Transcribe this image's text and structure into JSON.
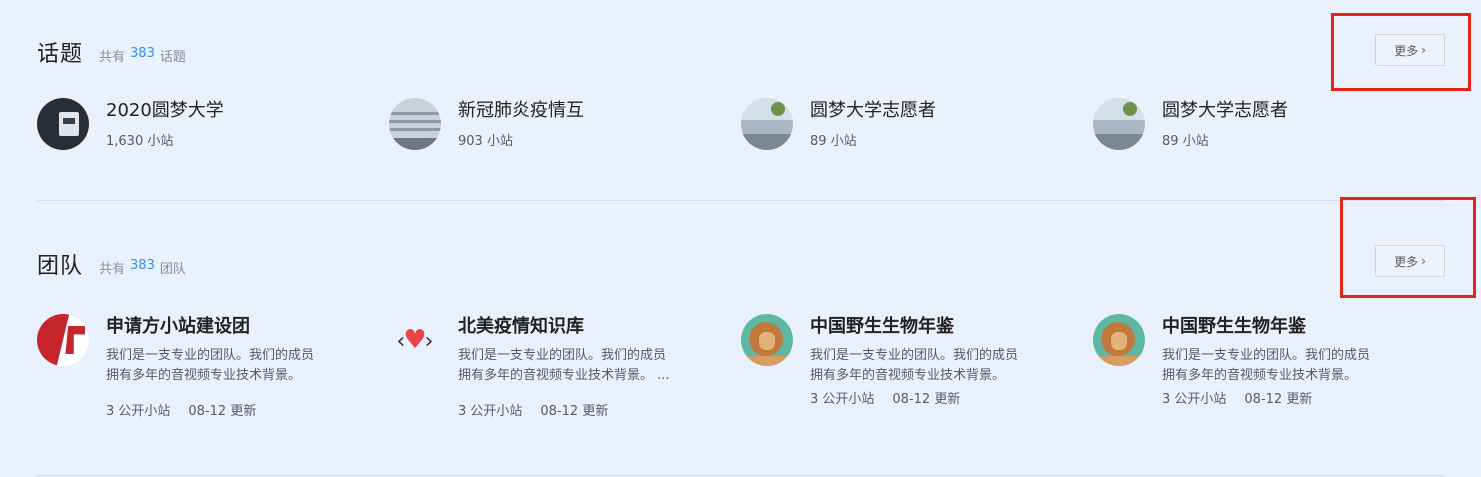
{
  "topics": {
    "title": "话题",
    "count_prefix": "共有",
    "count": "383",
    "count_suffix": "话题",
    "more_label": "更多",
    "more_icon": "chevron-right-icon",
    "items": [
      {
        "title": "2020圆梦大学",
        "sub": "1,630 小站"
      },
      {
        "title": "新冠肺炎疫情互",
        "sub": "903 小站"
      },
      {
        "title": "圆梦大学志愿者",
        "sub": "89 小站"
      },
      {
        "title": "圆梦大学志愿者",
        "sub": "89 小站"
      }
    ]
  },
  "teams": {
    "title": "团队",
    "count_prefix": "共有",
    "count": "383",
    "count_suffix": "团队",
    "more_label": "更多",
    "more_icon": "chevron-right-icon",
    "items": [
      {
        "title": "申请方小站建设团",
        "desc_1": "我们是一支专业的团队。我们的成员",
        "desc_2": "拥有多年的音视频专业技术背景。",
        "sites": "3 公开小站",
        "updated": "08-12 更新"
      },
      {
        "title": "北美疫情知识库",
        "desc_1": "我们是一支专业的团队。我们的成员",
        "desc_2": "拥有多年的音视频专业技术背景。 ...",
        "sites": "3 公开小站",
        "updated": "08-12 更新"
      },
      {
        "title": "中国野生生物年鉴",
        "desc_1": "我们是一支专业的团队。我们的成员",
        "desc_2": "拥有多年的音视频专业技术背景。",
        "sites": "3 公开小站",
        "updated": "08-12 更新"
      },
      {
        "title": "中国野生生物年鉴",
        "desc_1": "我们是一支专业的团队。我们的成员",
        "desc_2": "拥有多年的音视频专业技术背景。",
        "sites": "3 公开小站",
        "updated": "08-12 更新"
      }
    ]
  },
  "colors": {
    "background": "#e9f1fd",
    "count_accent": "#3a8ee6",
    "highlight_box": "#e5231b"
  }
}
